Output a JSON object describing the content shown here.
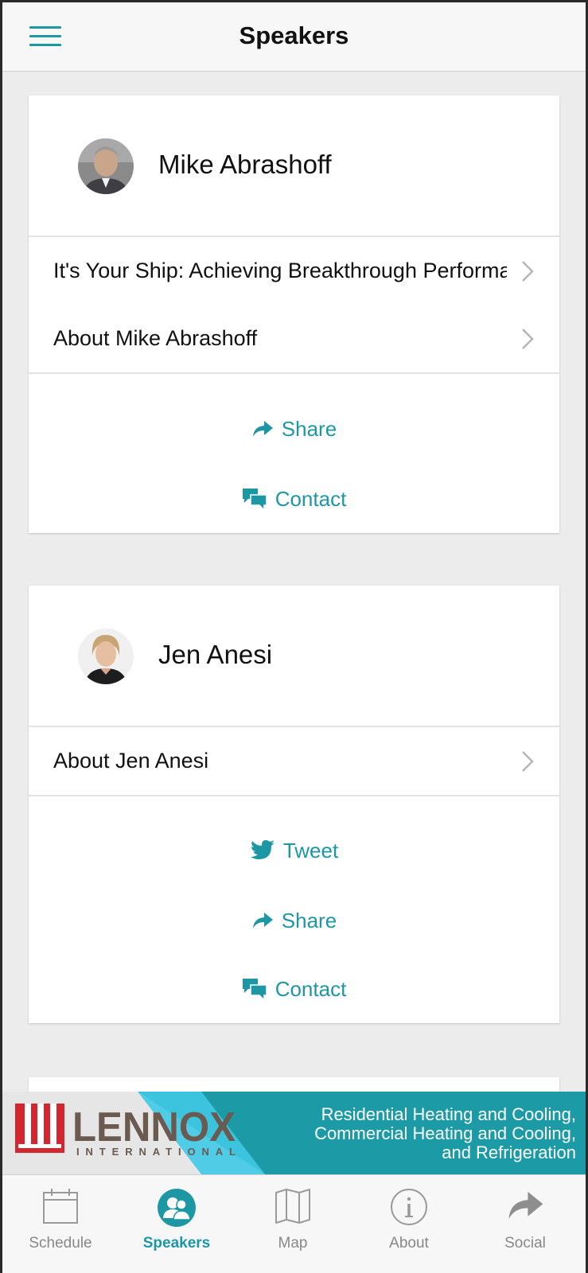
{
  "header": {
    "title": "Speakers",
    "menu_icon": "hamburger-menu-icon"
  },
  "speakers": [
    {
      "name": "Mike Abrashoff",
      "rows": [
        {
          "label": "It's Your Ship: Achieving Breakthrough Performance"
        },
        {
          "label": "About Mike Abrashoff"
        }
      ],
      "actions": [
        {
          "label": "Share",
          "icon": "share-arrow-icon"
        },
        {
          "label": "Contact",
          "icon": "chat-bubbles-icon"
        }
      ]
    },
    {
      "name": "Jen Anesi",
      "rows": [
        {
          "label": "About Jen Anesi"
        }
      ],
      "actions": [
        {
          "label": "Tweet",
          "icon": "twitter-bird-icon"
        },
        {
          "label": "Share",
          "icon": "share-arrow-icon"
        },
        {
          "label": "Contact",
          "icon": "chat-bubbles-icon"
        }
      ]
    }
  ],
  "banner": {
    "logo_text": "LENNOX",
    "logo_subtext": "INTERNATIONAL",
    "tagline": [
      "Residential Heating and Cooling,",
      "Commercial Heating and Cooling,",
      "and Refrigeration"
    ]
  },
  "tabs": [
    {
      "label": "Schedule",
      "icon": "calendar-icon",
      "active": false
    },
    {
      "label": "Speakers",
      "icon": "people-icon",
      "active": true
    },
    {
      "label": "Map",
      "icon": "map-icon",
      "active": false
    },
    {
      "label": "About",
      "icon": "info-icon",
      "active": false
    },
    {
      "label": "Social",
      "icon": "share-arrow-icon",
      "active": false
    }
  ],
  "colors": {
    "accent": "#1e97a5",
    "background": "#ececec",
    "brand_red": "#d22630",
    "brand_gray": "#6a5a4f"
  }
}
